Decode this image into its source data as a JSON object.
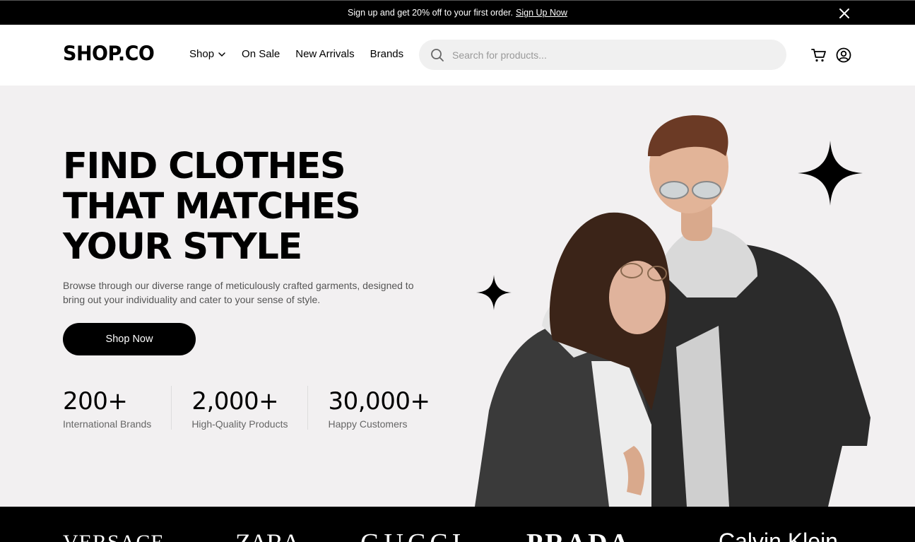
{
  "promo": {
    "text": "Sign up and get 20% off to your first order.",
    "link": "Sign Up Now"
  },
  "header": {
    "logo": "SHOP.CO",
    "nav": [
      "Shop",
      "On Sale",
      "New Arrivals",
      "Brands"
    ],
    "search_placeholder": "Search for products..."
  },
  "hero": {
    "headline": [
      "FIND CLOTHES",
      "THAT MATCHES",
      "YOUR STYLE"
    ],
    "subtitle": "Browse through our diverse range of meticulously crafted garments, designed to bring out your individuality and cater to your sense of style.",
    "cta": "Shop Now",
    "stats": [
      {
        "value": "200+",
        "label": "International Brands"
      },
      {
        "value": "2,000+",
        "label": "High-Quality Products"
      },
      {
        "value": "30,000+",
        "label": "Happy Customers"
      }
    ]
  },
  "brands": [
    "VERSACE",
    "ZARA",
    "GUCCI",
    "PRADA",
    "Calvin Klein"
  ],
  "colors": {
    "dark": "#000000",
    "hero_bg": "#F2F0F1",
    "search_bg": "#F0F0F0"
  }
}
